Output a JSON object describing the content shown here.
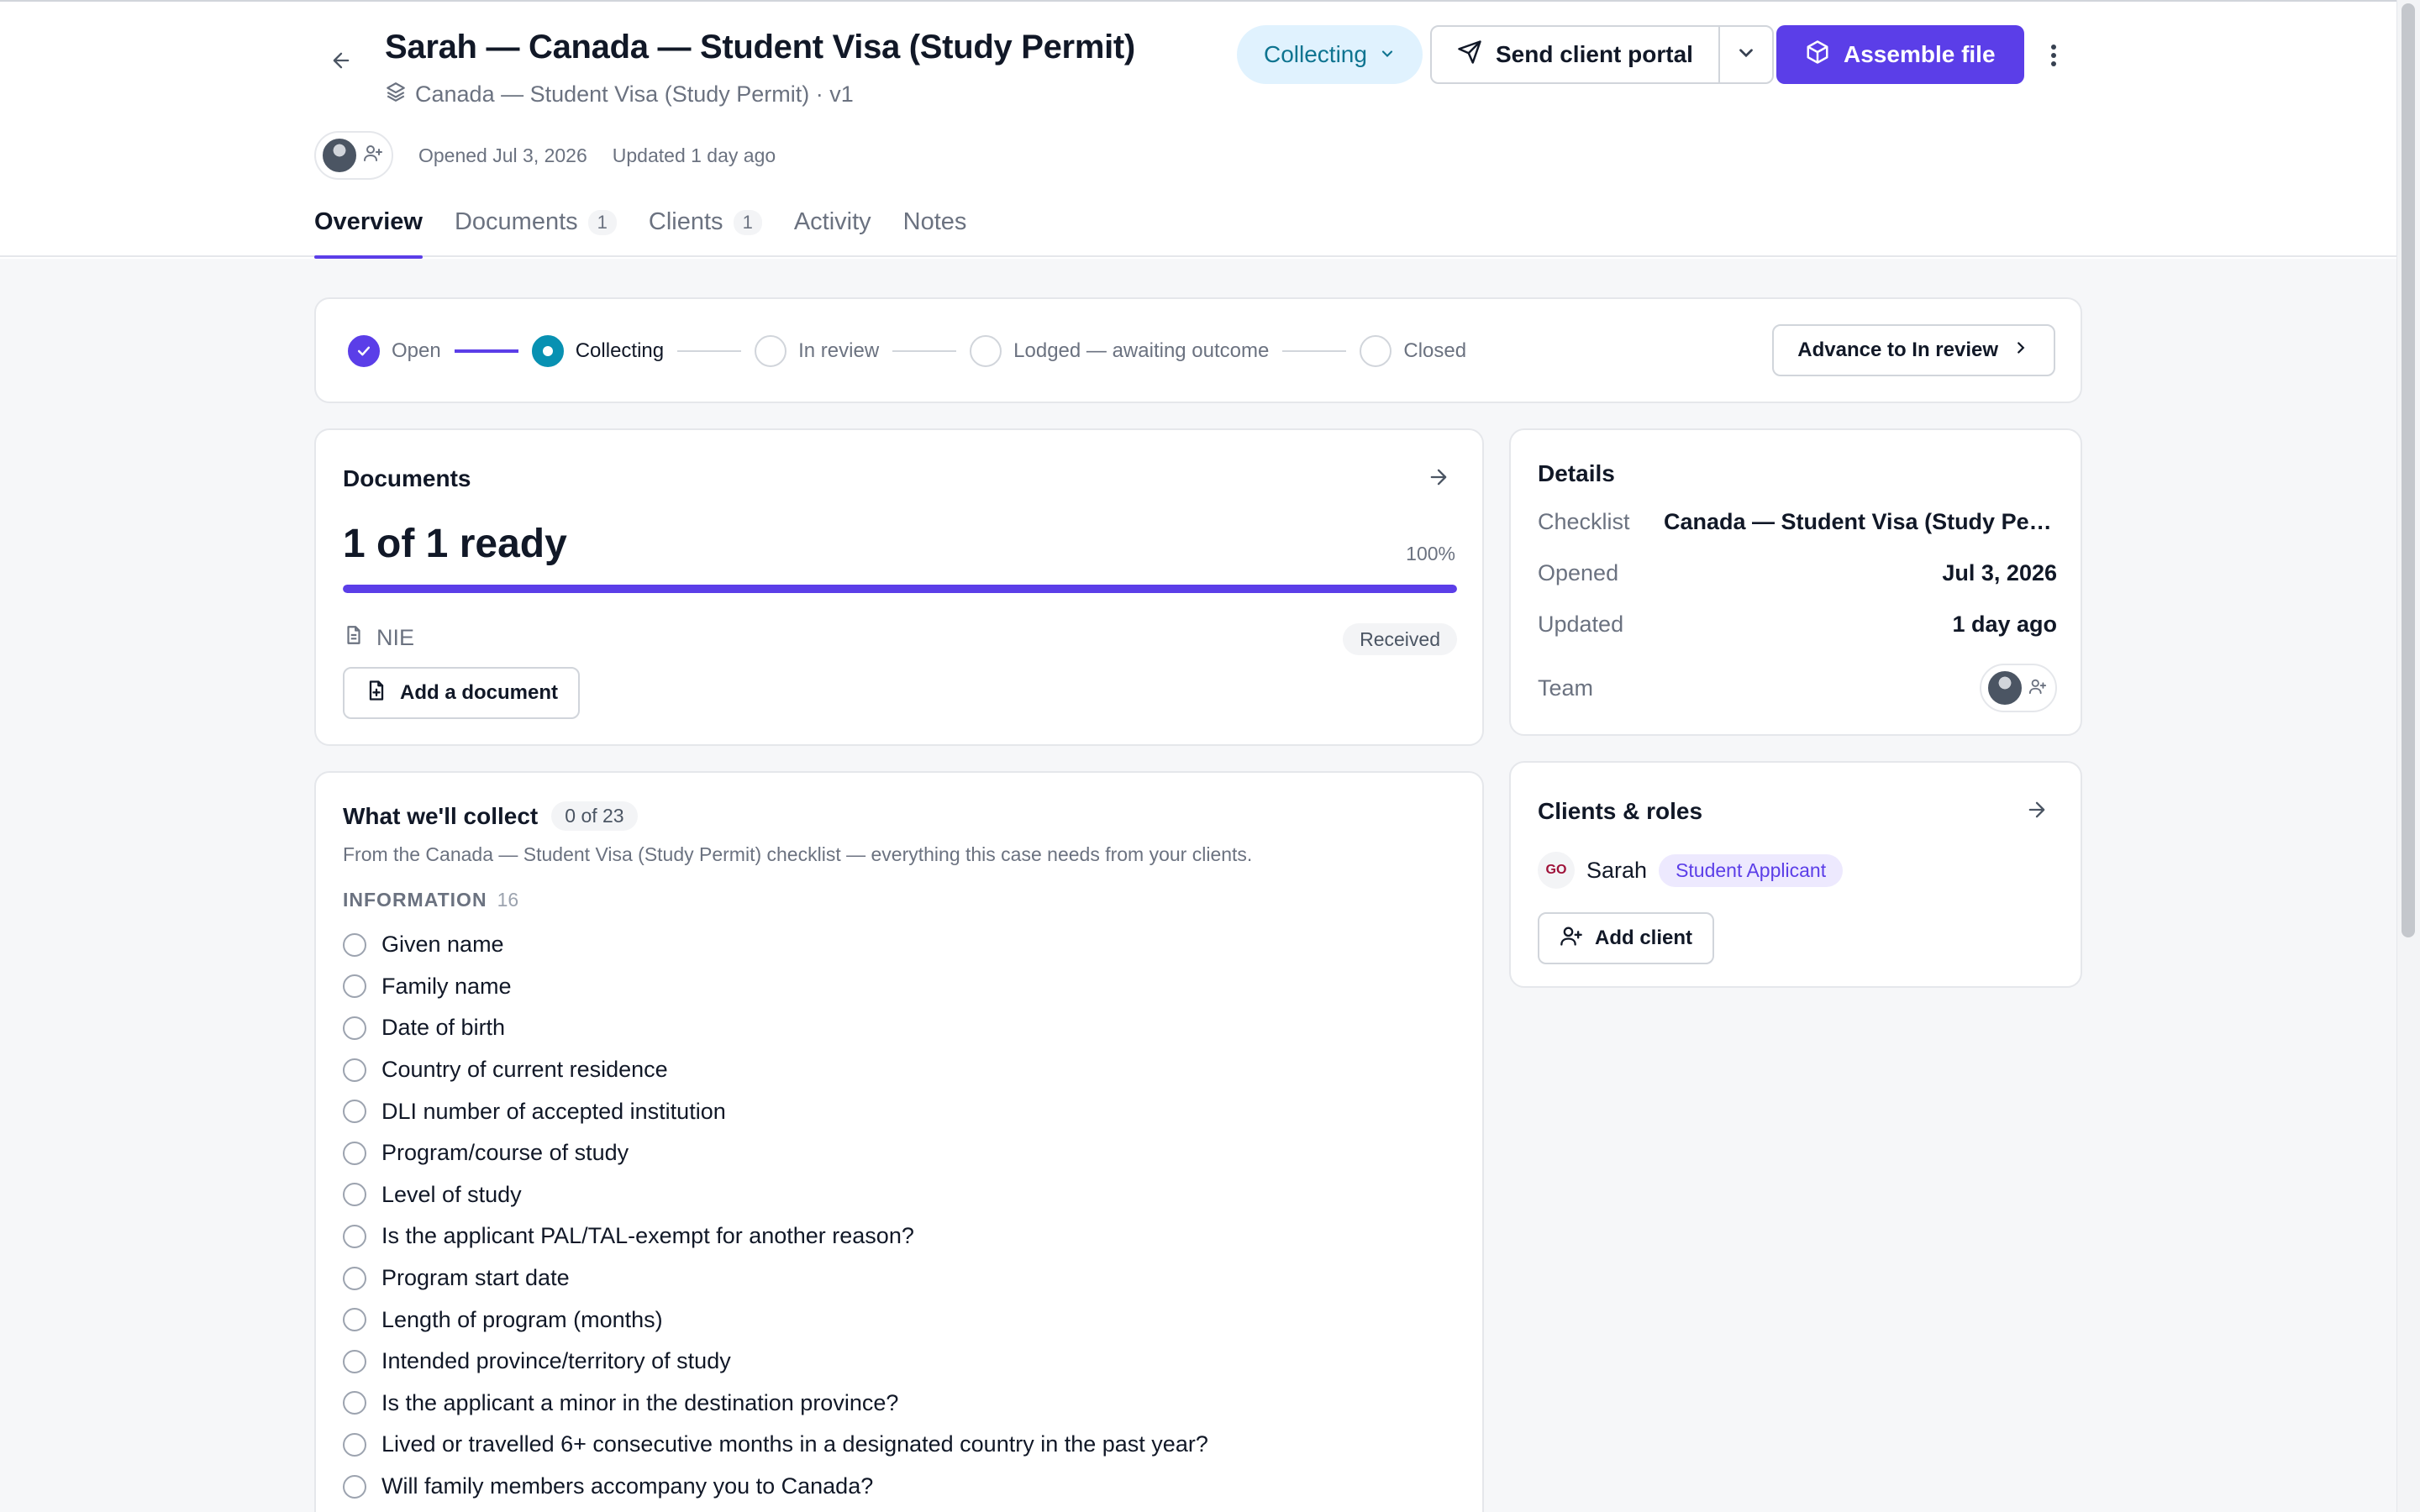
{
  "case": {
    "title": "Sarah — Canada — Student Visa (Study Permit)",
    "subtitle": "Canada — Student Visa (Study Permit) · v1",
    "opened": "Opened Jul 3, 2026",
    "updated": "Updated 1 day ago"
  },
  "actions": {
    "status": "Collecting",
    "send_portal": "Send client portal",
    "assemble": "Assemble file"
  },
  "tabs": [
    {
      "label": "Overview",
      "count": ""
    },
    {
      "label": "Documents",
      "count": "1"
    },
    {
      "label": "Clients",
      "count": "1"
    },
    {
      "label": "Activity",
      "count": ""
    },
    {
      "label": "Notes",
      "count": ""
    }
  ],
  "stepper": {
    "steps": [
      "Open",
      "Collecting",
      "In review",
      "Lodged — awaiting outcome",
      "Closed"
    ],
    "advance": "Advance to In review"
  },
  "documents": {
    "title": "Documents",
    "summary": "1 of 1 ready",
    "percent_label": "100%",
    "progress": 1.0,
    "items": [
      {
        "name": "NIE",
        "status": "Received"
      }
    ],
    "add_label": "Add a document"
  },
  "collect": {
    "title": "What we'll collect",
    "count": "0 of 23",
    "description": "From the Canada — Student Visa (Study Permit) checklist — everything this case needs from your clients.",
    "section": "INFORMATION",
    "section_count": "16",
    "items": [
      "Given name",
      "Family name",
      "Date of birth",
      "Country of current residence",
      "DLI number of accepted institution",
      "Program/course of study",
      "Level of study",
      "Is the applicant PAL/TAL-exempt for another reason?",
      "Program start date",
      "Length of program (months)",
      "Intended province/territory of study",
      "Is the applicant a minor in the destination province?",
      "Lived or travelled 6+ consecutive months in a designated country in the past year?",
      "Will family members accompany you to Canada?"
    ]
  },
  "details": {
    "title": "Details",
    "checklist_label": "Checklist",
    "checklist_value": "Canada — Student Visa (Study Permit)",
    "opened_label": "Opened",
    "opened_value": "Jul 3, 2026",
    "updated_label": "Updated",
    "updated_value": "1 day ago",
    "team_label": "Team"
  },
  "clients": {
    "title": "Clients & roles",
    "list": [
      {
        "initials": "GO",
        "name": "Sarah",
        "role": "Student Applicant"
      }
    ],
    "add_label": "Add client"
  },
  "colors": {
    "accent": "#5b3ee8",
    "status": "#0891b2",
    "status_bg": "#e0f2fe"
  }
}
